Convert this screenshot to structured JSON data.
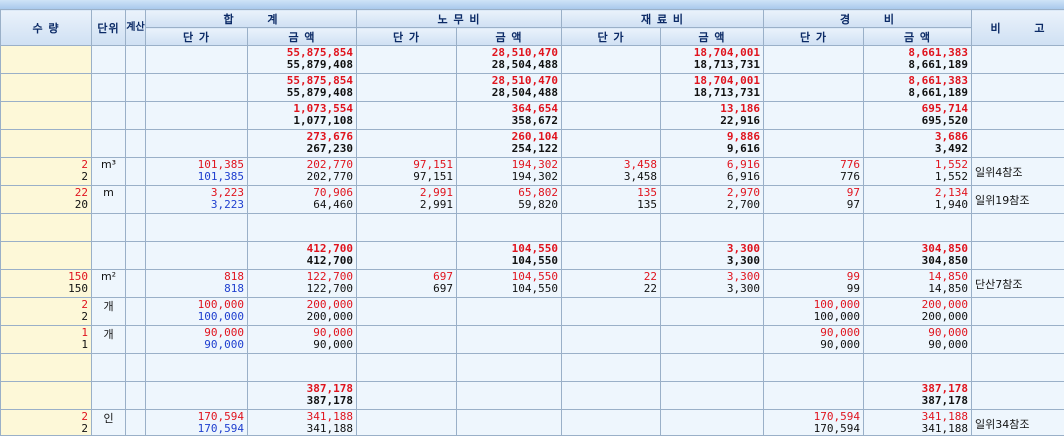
{
  "header": {
    "qty": "수 량",
    "unit": "단위",
    "calc": "계산",
    "total": "합  계",
    "labor": "노 무 비",
    "material": "재 료 비",
    "expense": "경  비",
    "note": "비  고",
    "unit_price": "단  가",
    "amount": "금  액"
  },
  "rows": [
    {
      "qty1": "",
      "qty2": "",
      "unit": "",
      "t_up1": "",
      "t_up2": "",
      "t_am1": "55,875,854",
      "t_am2": "55,879,408",
      "l_up1": "",
      "l_up2": "",
      "l_am1": "28,510,470",
      "l_am2": "28,504,488",
      "m_up1": "",
      "m_up2": "",
      "m_am1": "18,704,001",
      "m_am2": "18,713,731",
      "e_up1": "",
      "e_up2": "",
      "e_am1": "8,661,383",
      "e_am2": "8,661,189",
      "note": "",
      "bold": true
    },
    {
      "qty1": "",
      "qty2": "",
      "unit": "",
      "t_up1": "",
      "t_up2": "",
      "t_am1": "55,875,854",
      "t_am2": "55,879,408",
      "l_up1": "",
      "l_up2": "",
      "l_am1": "28,510,470",
      "l_am2": "28,504,488",
      "m_up1": "",
      "m_up2": "",
      "m_am1": "18,704,001",
      "m_am2": "18,713,731",
      "e_up1": "",
      "e_up2": "",
      "e_am1": "8,661,383",
      "e_am2": "8,661,189",
      "note": "",
      "bold": true
    },
    {
      "qty1": "",
      "qty2": "",
      "unit": "",
      "t_up1": "",
      "t_up2": "",
      "t_am1": "1,073,554",
      "t_am2": "1,077,108",
      "l_up1": "",
      "l_up2": "",
      "l_am1": "364,654",
      "l_am2": "358,672",
      "m_up1": "",
      "m_up2": "",
      "m_am1": "13,186",
      "m_am2": "22,916",
      "e_up1": "",
      "e_up2": "",
      "e_am1": "695,714",
      "e_am2": "695,520",
      "note": "",
      "bold": true
    },
    {
      "qty1": "",
      "qty2": "",
      "unit": "",
      "t_up1": "",
      "t_up2": "",
      "t_am1": "273,676",
      "t_am2": "267,230",
      "l_up1": "",
      "l_up2": "",
      "l_am1": "260,104",
      "l_am2": "254,122",
      "m_up1": "",
      "m_up2": "",
      "m_am1": "9,886",
      "m_am2": "9,616",
      "e_up1": "",
      "e_up2": "",
      "e_am1": "3,686",
      "e_am2": "3,492",
      "note": "",
      "bold": true
    },
    {
      "qty1": "2",
      "qty2": "2",
      "unit": "m³",
      "t_up1": "101,385",
      "t_up2": "101,385",
      "t_am1": "202,770",
      "t_am2": "202,770",
      "l_up1": "97,151",
      "l_up2": "97,151",
      "l_am1": "194,302",
      "l_am2": "194,302",
      "m_up1": "3,458",
      "m_up2": "3,458",
      "m_am1": "6,916",
      "m_am2": "6,916",
      "e_up1": "776",
      "e_up2": "776",
      "e_am1": "1,552",
      "e_am2": "1,552",
      "note": "일위4참조",
      "bold": false
    },
    {
      "qty1": "22",
      "qty2": "20",
      "unit": "m",
      "t_up1": "3,223",
      "t_up2": "3,223",
      "t_am1": "70,906",
      "t_am2": "64,460",
      "l_up1": "2,991",
      "l_up2": "2,991",
      "l_am1": "65,802",
      "l_am2": "59,820",
      "m_up1": "135",
      "m_up2": "135",
      "m_am1": "2,970",
      "m_am2": "2,700",
      "e_up1": "97",
      "e_up2": "97",
      "e_am1": "2,134",
      "e_am2": "1,940",
      "note": "일위19참조",
      "bold": false
    },
    {
      "qty1": "",
      "qty2": "",
      "unit": "",
      "t_up1": "",
      "t_up2": "",
      "t_am1": "",
      "t_am2": "",
      "l_up1": "",
      "l_up2": "",
      "l_am1": "",
      "l_am2": "",
      "m_up1": "",
      "m_up2": "",
      "m_am1": "",
      "m_am2": "",
      "e_up1": "",
      "e_up2": "",
      "e_am1": "",
      "e_am2": "",
      "note": "",
      "bold": false
    },
    {
      "qty1": "",
      "qty2": "",
      "unit": "",
      "t_up1": "",
      "t_up2": "",
      "t_am1": "412,700",
      "t_am2": "412,700",
      "l_up1": "",
      "l_up2": "",
      "l_am1": "104,550",
      "l_am2": "104,550",
      "m_up1": "",
      "m_up2": "",
      "m_am1": "3,300",
      "m_am2": "3,300",
      "e_up1": "",
      "e_up2": "",
      "e_am1": "304,850",
      "e_am2": "304,850",
      "note": "",
      "bold": true
    },
    {
      "qty1": "150",
      "qty2": "150",
      "unit": "m²",
      "t_up1": "818",
      "t_up2": "818",
      "t_am1": "122,700",
      "t_am2": "122,700",
      "l_up1": "697",
      "l_up2": "697",
      "l_am1": "104,550",
      "l_am2": "104,550",
      "m_up1": "22",
      "m_up2": "22",
      "m_am1": "3,300",
      "m_am2": "3,300",
      "e_up1": "99",
      "e_up2": "99",
      "e_am1": "14,850",
      "e_am2": "14,850",
      "note": "단산7참조",
      "bold": false
    },
    {
      "qty1": "2",
      "qty2": "2",
      "unit": "개",
      "t_up1": "100,000",
      "t_up2": "100,000",
      "t_am1": "200,000",
      "t_am2": "200,000",
      "l_up1": "",
      "l_up2": "",
      "l_am1": "",
      "l_am2": "",
      "m_up1": "",
      "m_up2": "",
      "m_am1": "",
      "m_am2": "",
      "e_up1": "100,000",
      "e_up2": "100,000",
      "e_am1": "200,000",
      "e_am2": "200,000",
      "note": "",
      "bold": false
    },
    {
      "qty1": "1",
      "qty2": "1",
      "unit": "개",
      "t_up1": "90,000",
      "t_up2": "90,000",
      "t_am1": "90,000",
      "t_am2": "90,000",
      "l_up1": "",
      "l_up2": "",
      "l_am1": "",
      "l_am2": "",
      "m_up1": "",
      "m_up2": "",
      "m_am1": "",
      "m_am2": "",
      "e_up1": "90,000",
      "e_up2": "90,000",
      "e_am1": "90,000",
      "e_am2": "90,000",
      "note": "",
      "bold": false
    },
    {
      "qty1": "",
      "qty2": "",
      "unit": "",
      "t_up1": "",
      "t_up2": "",
      "t_am1": "",
      "t_am2": "",
      "l_up1": "",
      "l_up2": "",
      "l_am1": "",
      "l_am2": "",
      "m_up1": "",
      "m_up2": "",
      "m_am1": "",
      "m_am2": "",
      "e_up1": "",
      "e_up2": "",
      "e_am1": "",
      "e_am2": "",
      "note": "",
      "bold": false
    },
    {
      "qty1": "",
      "qty2": "",
      "unit": "",
      "t_up1": "",
      "t_up2": "",
      "t_am1": "387,178",
      "t_am2": "387,178",
      "l_up1": "",
      "l_up2": "",
      "l_am1": "",
      "l_am2": "",
      "m_up1": "",
      "m_up2": "",
      "m_am1": "",
      "m_am2": "",
      "e_up1": "",
      "e_up2": "",
      "e_am1": "387,178",
      "e_am2": "387,178",
      "note": "",
      "bold": true
    },
    {
      "qty1": "2",
      "qty2": "2",
      "unit": "인",
      "t_up1": "170,594",
      "t_up2": "170,594",
      "t_am1": "341,188",
      "t_am2": "341,188",
      "l_up1": "",
      "l_up2": "",
      "l_am1": "",
      "l_am2": "",
      "m_up1": "",
      "m_up2": "",
      "m_am1": "",
      "m_am2": "",
      "e_up1": "170,594",
      "e_up2": "170,594",
      "e_am1": "341,188",
      "e_am2": "341,188",
      "note": "일위34참조",
      "bold": false
    }
  ]
}
